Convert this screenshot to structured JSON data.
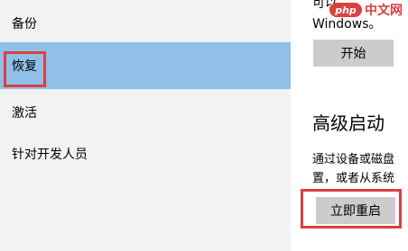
{
  "sidebar": {
    "items": [
      {
        "label": "备份",
        "selected": false
      },
      {
        "label": "恢复",
        "selected": true
      },
      {
        "label": "激活",
        "selected": false
      },
      {
        "label": "针对开发人员",
        "selected": false
      }
    ]
  },
  "main": {
    "reset_section": {
      "partial_text": "可以",
      "windows_text": "Windows。",
      "start_button": "开始"
    },
    "advanced_startup": {
      "heading": "高级启动",
      "description_line1": "通过设备或磁盘",
      "description_line2": "置，或者从系统",
      "restart_button": "立即重启"
    }
  },
  "watermark": {
    "logo": "php",
    "text": "中文网"
  },
  "colors": {
    "sidebar_bg": "#f2f2f2",
    "selected_bg": "#90bfe8",
    "highlight_border": "#d9403f",
    "button_bg": "#cccccc"
  }
}
